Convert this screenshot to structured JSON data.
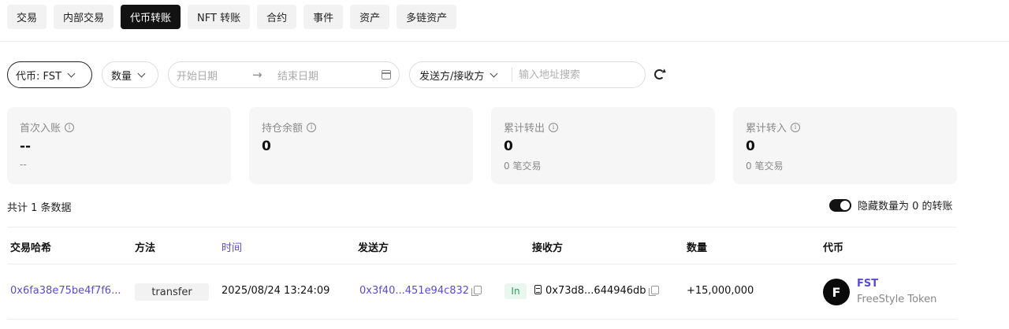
{
  "tabs": [
    {
      "label": "交易",
      "active": false
    },
    {
      "label": "内部交易",
      "active": false
    },
    {
      "label": "代币转账",
      "active": true
    },
    {
      "label": "NFT 转账",
      "active": false
    },
    {
      "label": "合约",
      "active": false
    },
    {
      "label": "事件",
      "active": false
    },
    {
      "label": "资产",
      "active": false
    },
    {
      "label": "多链资产",
      "active": false
    }
  ],
  "filters": {
    "token_filter": "代币: FST",
    "quantity_filter": "数量",
    "start_date_placeholder": "开始日期",
    "end_date_placeholder": "结束日期",
    "direction_filter": "发送方/接收方",
    "address_search_placeholder": "输入地址搜索"
  },
  "cards": [
    {
      "label": "首次入账",
      "value": "--",
      "sub": "--"
    },
    {
      "label": "持仓余额",
      "value": "0",
      "sub": ""
    },
    {
      "label": "累计转出",
      "value": "0",
      "sub": "0 笔交易"
    },
    {
      "label": "累计转入",
      "value": "0",
      "sub": "0 笔交易"
    }
  ],
  "summary": "共计 1 条数据",
  "hide_zero_toggle": {
    "label": "隐藏数量为 0 的转账",
    "on": true
  },
  "table": {
    "headers": {
      "tx_hash": "交易哈希",
      "method": "方法",
      "time": "时间",
      "from": "发送方",
      "to": "接收方",
      "amount": "数量",
      "token": "代币"
    },
    "rows": [
      {
        "tx_hash": "0x6fa38e75be4f7f6...",
        "method": "transfer",
        "time": "2025/08/24 13:24:09",
        "from": "0x3f40...451e94c832",
        "direction": "In",
        "to": "0x73d8...644946db",
        "amount": "+15,000,000",
        "token_logo": "F",
        "token_symbol": "FST",
        "token_name": "FreeStyle Token"
      }
    ]
  },
  "colors": {
    "accent_link": "#5a4bd1",
    "active_tab": "#121212",
    "in_badge": "#27a05a"
  }
}
